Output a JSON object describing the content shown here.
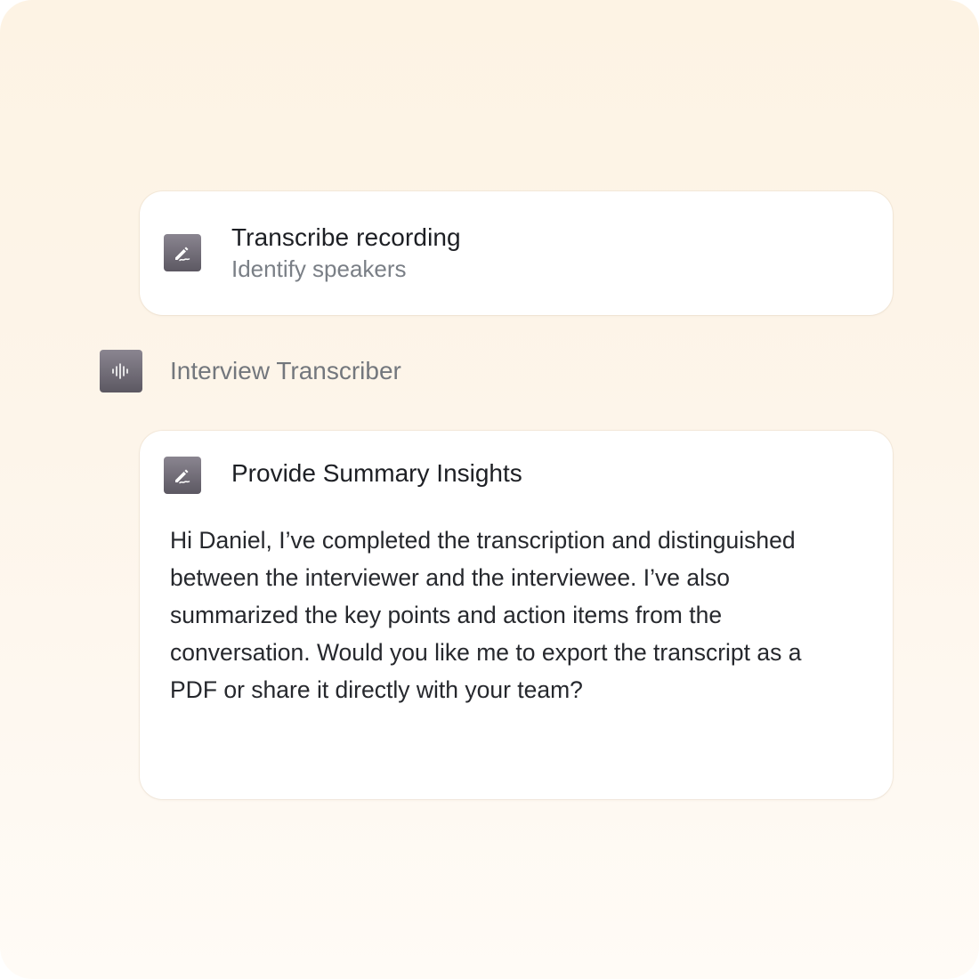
{
  "task_card": {
    "icon": "edit-pen-icon",
    "title": "Transcribe recording",
    "subtitle": "Identify speakers"
  },
  "agent": {
    "icon": "audio-waveform-icon",
    "name": "Interview Transcriber"
  },
  "response_card": {
    "icon": "edit-pen-icon",
    "title": "Provide Summary Insights",
    "body": "Hi Daniel, I’ve completed the transcription and distinguished between the interviewer and the interviewee. I’ve also summarized the key points and action items from the conversation. Would you like me to export the transcript as a PDF or share it directly with your team?"
  },
  "colors": {
    "background_top": "#fdf3e4",
    "background_bottom": "#fffbf6",
    "card": "#ffffff",
    "icon_tile": "#6f6a75",
    "title_text": "#1d1f24",
    "muted_text": "#7a7f86"
  }
}
